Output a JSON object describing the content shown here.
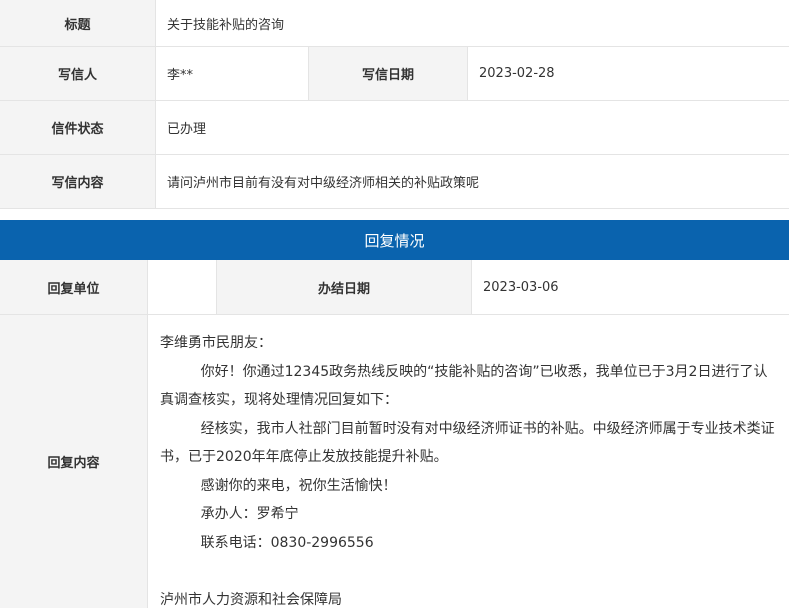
{
  "letter": {
    "title_label": "标题",
    "title_value": "关于技能补贴的咨询",
    "writer_label": "写信人",
    "writer_value": "李**",
    "date_label": "写信日期",
    "date_value": "2023-02-28",
    "status_label": "信件状态",
    "status_value": "已办理",
    "content_label": "写信内容",
    "content_value": "请问泸州市目前有没有对中级经济师相关的补贴政策呢"
  },
  "reply": {
    "section_title": "回复情况",
    "unit_label": "回复单位",
    "unit_value": "",
    "finish_label": "办结日期",
    "finish_value": "2023-03-06",
    "content_label": "回复内容",
    "greeting": "李维勇市民朋友：",
    "para1": "你好！你通过12345政务热线反映的“技能补贴的咨询”已收悉，我单位已于3月2日进行了认真调查核实，现将处理情况回复如下：",
    "para2": "经核实，我市人社部门目前暂时没有对中级经济师证书的补贴。中级经济师属于专业技术类证书，已于2020年年底停止发放技能提升补贴。",
    "thanks": "感谢你的来电，祝你生活愉快！",
    "handler": "承办人：罗希宁",
    "phone": "联系电话：0830-2996556",
    "signature": "泸州市人力资源和社会保障局"
  }
}
